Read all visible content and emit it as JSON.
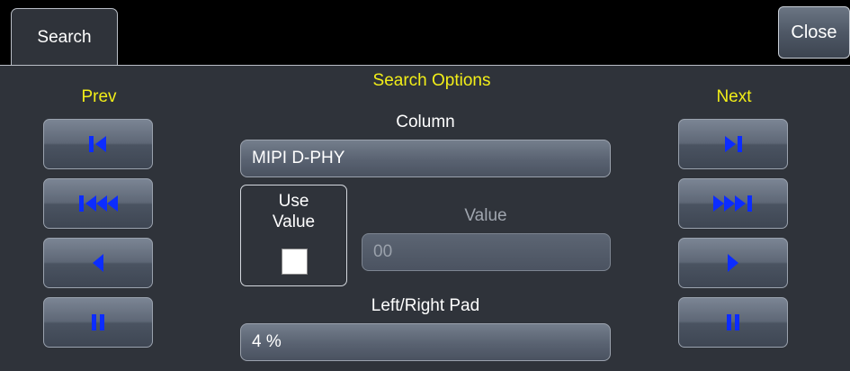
{
  "tabs": [
    {
      "label": "Search"
    }
  ],
  "close_label": "Close",
  "section_title": "Search Options",
  "prev": {
    "label": "Prev",
    "buttons": [
      "skip-to-first-icon",
      "fast-rewind-icon",
      "step-back-icon",
      "pause-icon"
    ]
  },
  "next": {
    "label": "Next",
    "buttons": [
      "skip-to-last-icon",
      "fast-forward-icon",
      "step-forward-icon",
      "pause-icon"
    ]
  },
  "column": {
    "label": "Column",
    "value": "MIPI D-PHY"
  },
  "use_value": {
    "label_line1": "Use",
    "label_line2": "Value",
    "checked": false
  },
  "value": {
    "label": "Value",
    "value": "00",
    "enabled": false
  },
  "pad": {
    "label": "Left/Right Pad",
    "value": "4 %"
  },
  "colors": {
    "accent_yellow": "#f2ee18",
    "icon_blue": "#0c2cff",
    "panel_bg": "#2f333a"
  }
}
